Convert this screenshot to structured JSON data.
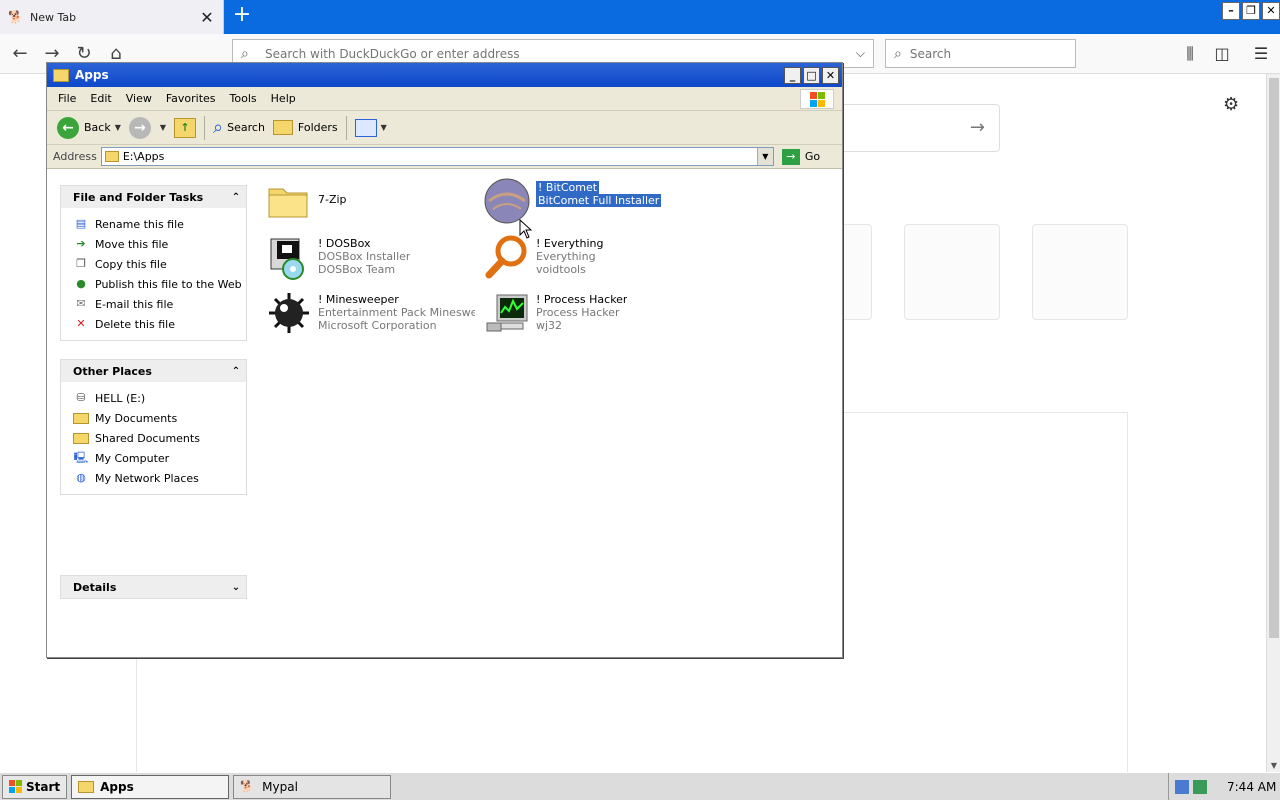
{
  "browser": {
    "tab_title": "New Tab",
    "url_placeholder": "Search with DuckDuckGo or enter address",
    "search_placeholder": "Search"
  },
  "window": {
    "title": "Apps",
    "menu": [
      "File",
      "Edit",
      "View",
      "Favorites",
      "Tools",
      "Help"
    ],
    "toolbar": {
      "back": "Back",
      "search": "Search",
      "folders": "Folders"
    },
    "address": {
      "label": "Address",
      "value": "E:\\Apps",
      "go": "Go"
    }
  },
  "tasks": {
    "file_folder": {
      "title": "File and Folder Tasks",
      "items": [
        {
          "label": "Rename this file",
          "icon": "rename-icon"
        },
        {
          "label": "Move this file",
          "icon": "move-icon"
        },
        {
          "label": "Copy this file",
          "icon": "copy-icon"
        },
        {
          "label": "Publish this file to the Web",
          "icon": "web-publish-icon"
        },
        {
          "label": "E-mail this file",
          "icon": "email-icon"
        },
        {
          "label": "Delete this file",
          "icon": "delete-icon"
        }
      ]
    },
    "other_places": {
      "title": "Other Places",
      "items": [
        {
          "label": "HELL (E:)",
          "icon": "drive-icon"
        },
        {
          "label": "My Documents",
          "icon": "documents-folder-icon"
        },
        {
          "label": "Shared Documents",
          "icon": "shared-folder-icon"
        },
        {
          "label": "My Computer",
          "icon": "computer-icon"
        },
        {
          "label": "My Network Places",
          "icon": "network-icon"
        }
      ]
    },
    "details": {
      "title": "Details"
    }
  },
  "files": [
    {
      "name": "7-Zip",
      "line2": "",
      "line3": "",
      "icon": "folder-icon"
    },
    {
      "name": "! BitComet",
      "line2": "BitComet Full Installer",
      "line3": "",
      "icon": "bitcomet-icon",
      "selected": true
    },
    {
      "name": "! DOSBox",
      "line2": "DOSBox Installer",
      "line3": "DOSBox Team",
      "icon": "dosbox-installer-icon"
    },
    {
      "name": "! Everything",
      "line2": "Everything",
      "line3": "voidtools",
      "icon": "everything-magnifier-icon"
    },
    {
      "name": "! Minesweeper",
      "line2": "Entertainment Pack Minesweе...",
      "line3": "Microsoft Corporation",
      "icon": "mine-icon"
    },
    {
      "name": "! Process Hacker",
      "line2": "Process Hacker",
      "line3": "wj32",
      "icon": "process-monitor-icon"
    }
  ],
  "taskbar": {
    "start": "Start",
    "items": [
      {
        "label": "Apps",
        "active": true
      },
      {
        "label": "Mypal",
        "active": false
      }
    ],
    "clock": "7:44 AM"
  },
  "colors": {
    "titlebar": "#0f48c9",
    "browser_tabbar": "#0a6ae0",
    "selection": "#316ac5",
    "xp_chrome": "#ece9d8"
  }
}
